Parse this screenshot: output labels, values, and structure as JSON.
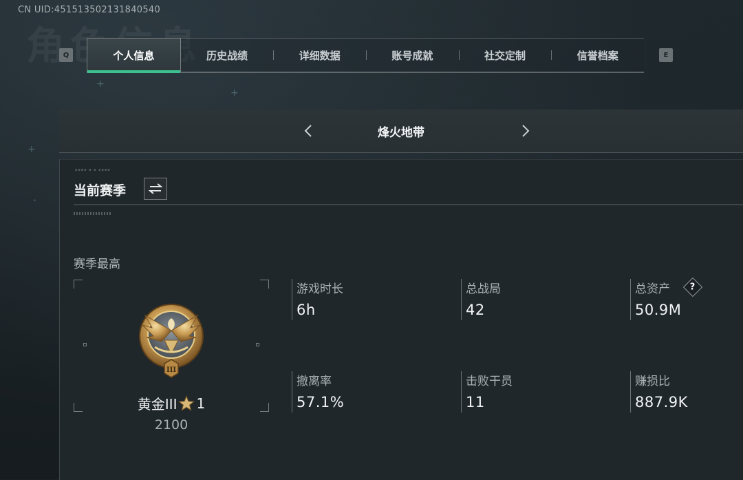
{
  "uid": "CN UID:451513502131840540",
  "bg_title": "角色信息",
  "keys": {
    "prev": "Q",
    "next": "E"
  },
  "tabs": [
    {
      "label": "个人信息",
      "active": true
    },
    {
      "label": "历史战绩",
      "active": false
    },
    {
      "label": "详细数据",
      "active": false
    },
    {
      "label": "账号成就",
      "active": false
    },
    {
      "label": "社交定制",
      "active": false
    },
    {
      "label": "信誉档案",
      "active": false
    }
  ],
  "mode": {
    "title": "烽火地带",
    "prev_icon": "chevron-left-icon",
    "next_icon": "chevron-right-icon"
  },
  "season": {
    "title": "当前赛季",
    "swap_icon": "swap-icon",
    "best_label": "赛季最高",
    "rank": {
      "name": "黄金III",
      "stars": "1",
      "score": "2100",
      "emblem_icon": "gold-eagle-emblem-icon"
    }
  },
  "stats": {
    "play_time": {
      "label": "游戏时长",
      "value": "6h"
    },
    "total_matches": {
      "label": "总战局",
      "value": "42"
    },
    "total_assets": {
      "label": "总资产",
      "value": "50.9M",
      "help_icon": "question-icon"
    },
    "extract_rate": {
      "label": "撤离率",
      "value": "57.1%"
    },
    "kills": {
      "label": "击败干员",
      "value": "11"
    },
    "profit_ratio": {
      "label": "赚损比",
      "value": "887.9K"
    }
  },
  "colors": {
    "accent": "#3ec190",
    "panel": "#20272b",
    "background": "#1b2226",
    "gold": "#c9a45c"
  }
}
